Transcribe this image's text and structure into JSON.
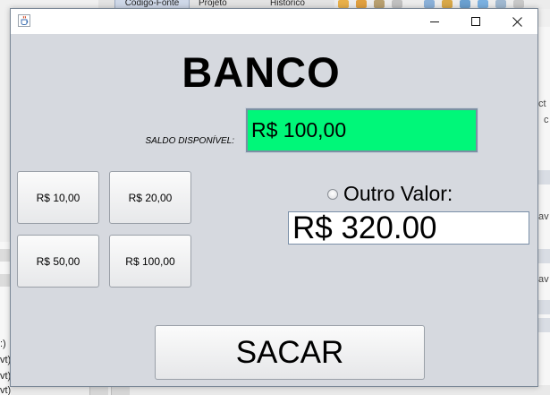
{
  "background_ide": {
    "tabs": [
      "Código-Fonte",
      "Projeto",
      "Histórico"
    ],
    "right_snippets": [
      "ct",
      "c",
      "av",
      "av"
    ],
    "left_snippets": [
      ":)",
      "vt)",
      "vt)",
      "vt)"
    ]
  },
  "window": {
    "icon": "java-cup-icon",
    "controls": {
      "minimize": "minimize-icon",
      "maximize": "maximize-icon",
      "close": "close-icon"
    }
  },
  "main": {
    "title": "BANCO",
    "saldo": {
      "label": "SALDO DISPONÍVEL:",
      "value": "R$ 100,00",
      "color": "#00f779"
    },
    "quick_values": [
      "R$ 10,00",
      "R$ 20,00",
      "R$ 50,00",
      "R$ 100,00"
    ],
    "outro_valor": {
      "label": "Outro Valor:",
      "selected": false,
      "value": "R$ 320.00"
    },
    "sacar_label": "SACAR"
  }
}
